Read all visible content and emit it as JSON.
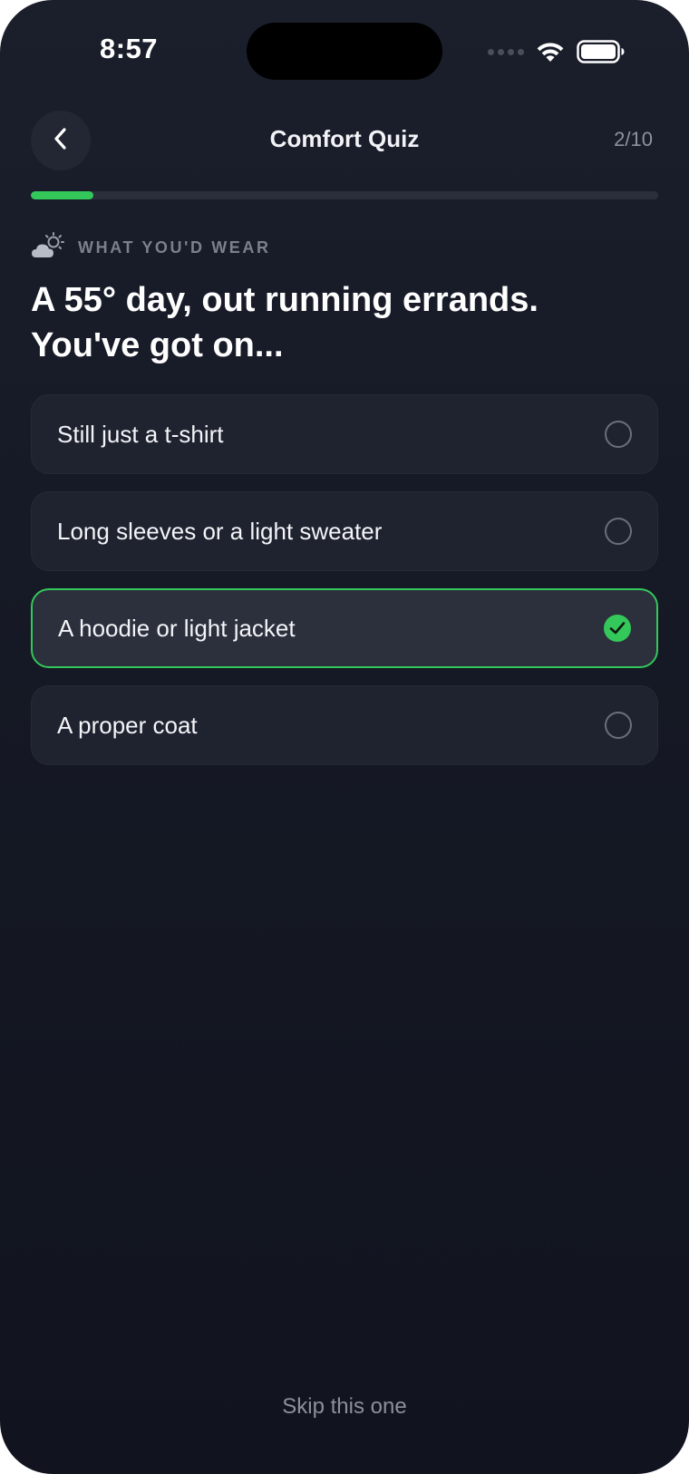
{
  "status_bar": {
    "time": "8:57"
  },
  "header": {
    "title": "Comfort Quiz",
    "step": "2/10",
    "progress_fraction": 0.1
  },
  "question": {
    "category": "WHAT YOU'D WEAR",
    "category_icon": "cloud-sun-icon",
    "text": "A 55° day, out running errands. You've got on..."
  },
  "options": [
    {
      "label": "Still just a t-shirt",
      "selected": false
    },
    {
      "label": "Long sleeves or a light sweater",
      "selected": false
    },
    {
      "label": "A hoodie or light jacket",
      "selected": true
    },
    {
      "label": "A proper coat",
      "selected": false
    }
  ],
  "footer": {
    "skip_label": "Skip this one"
  },
  "colors": {
    "accent": "#34c759",
    "background": "#161a26",
    "card": "#1f2330",
    "card_selected": "#2c2f3c"
  }
}
